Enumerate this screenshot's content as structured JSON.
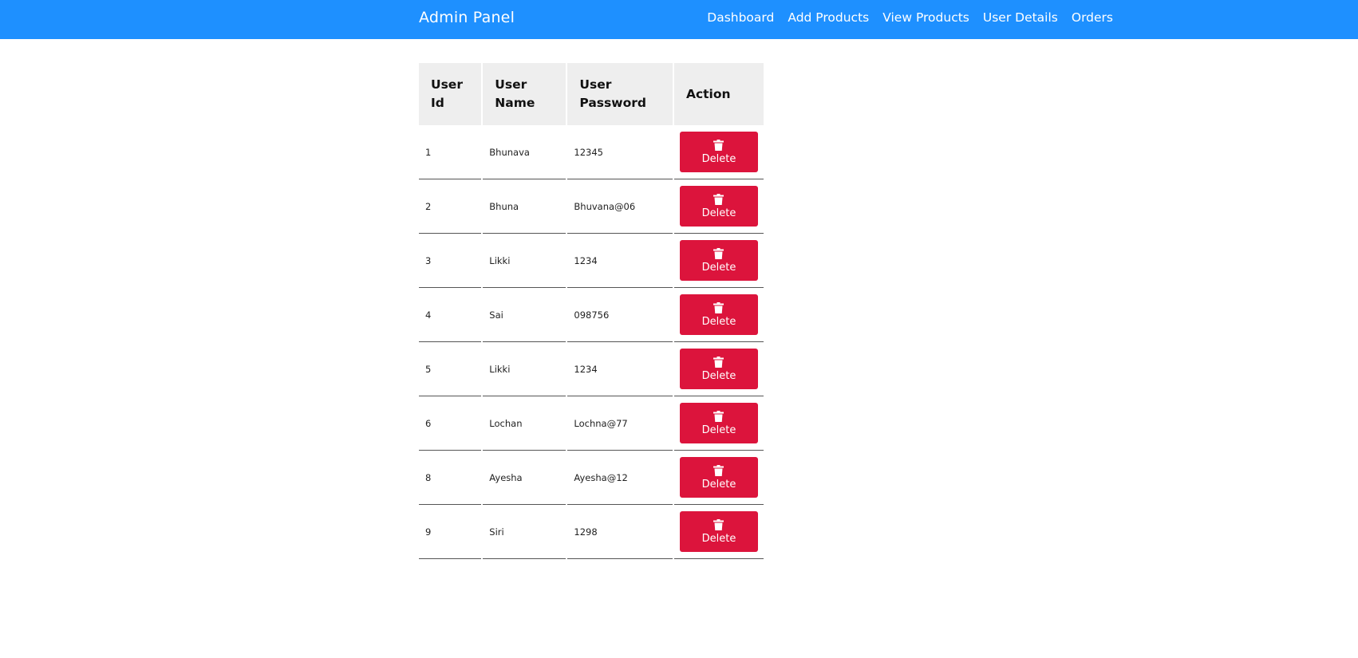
{
  "navbar": {
    "brand": "Admin Panel",
    "links": [
      "Dashboard",
      "Add Products",
      "View Products",
      "User Details",
      "Orders"
    ]
  },
  "table": {
    "headers": [
      "User Id",
      "User Name",
      "User Password",
      "Action"
    ],
    "rows": [
      {
        "id": "1",
        "name": "Bhunava",
        "password": "12345"
      },
      {
        "id": "2",
        "name": "Bhuna",
        "password": "Bhuvana@06"
      },
      {
        "id": "3",
        "name": "Likki",
        "password": "1234"
      },
      {
        "id": "4",
        "name": "Sai",
        "password": "098756"
      },
      {
        "id": "5",
        "name": "Likki",
        "password": "1234"
      },
      {
        "id": "6",
        "name": "Lochan",
        "password": "Lochna@77"
      },
      {
        "id": "8",
        "name": "Ayesha",
        "password": "Ayesha@12"
      },
      {
        "id": "9",
        "name": "Siri",
        "password": "1298"
      }
    ],
    "delete_label": "Delete",
    "delete_icon": "trash-icon"
  },
  "colors": {
    "navbar": "#1e90ff",
    "delete": "#dc143c",
    "header_bg": "#eeeeee"
  }
}
